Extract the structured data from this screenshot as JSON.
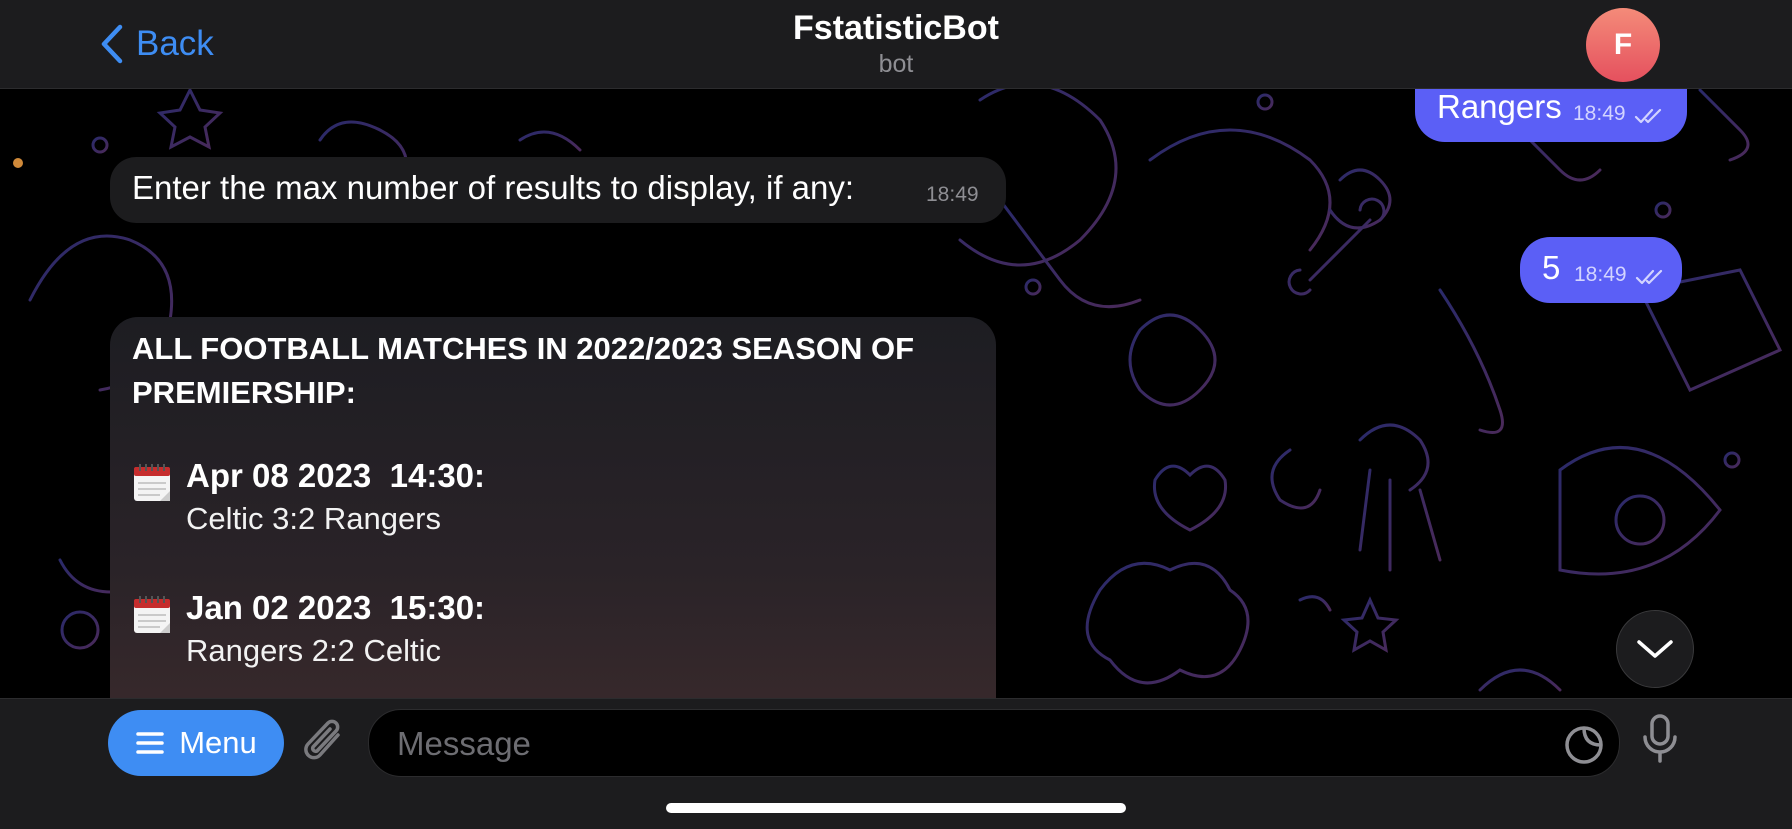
{
  "header": {
    "back_label": "Back",
    "title": "FstatisticBot",
    "subtitle": "bot",
    "avatar_initial": "F",
    "accent_color": "#3e8df3"
  },
  "messages": {
    "rangers": {
      "text": "Rangers",
      "time": "18:49"
    },
    "prompt": {
      "text": "Enter the max number of results to display, if any:",
      "time": "18:49"
    },
    "five": {
      "text": "5",
      "time": "18:49"
    },
    "result": {
      "heading": "ALL FOOTBALL MATCHES IN 2022/2023 SEASON OF PREMIERSHIP:",
      "matches": [
        {
          "icon": "calendar-icon",
          "date": "Apr 08 2023  14:30:",
          "score": "Celtic 3:2 Rangers"
        },
        {
          "icon": "calendar-icon",
          "date": "Jan 02 2023  15:30:",
          "score": "Rangers 2:2 Celtic"
        }
      ]
    }
  },
  "input_bar": {
    "menu_label": "Menu",
    "placeholder": "Message"
  },
  "colors": {
    "outgoing_bubble": "#5b5ff6",
    "incoming_bubble": "#1c1c1e",
    "avatar": "#e5505e"
  }
}
